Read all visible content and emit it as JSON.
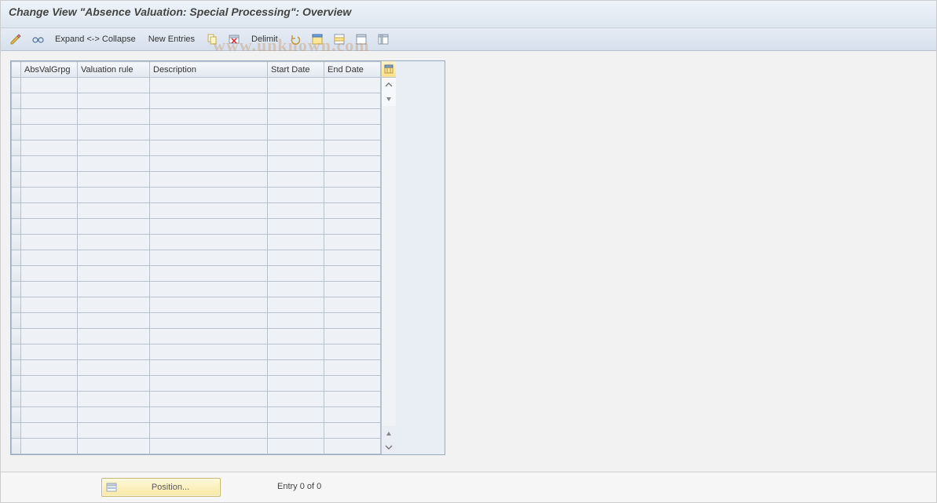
{
  "title": "Change View \"Absence Valuation: Special Processing\": Overview",
  "watermark": "www.unknown.com",
  "toolbar": {
    "expand_collapse": "Expand <-> Collapse",
    "new_entries": "New Entries",
    "delimit": "Delimit"
  },
  "columns": {
    "grpg": "AbsValGrpg",
    "rule": "Valuation rule",
    "desc": "Description",
    "start": "Start Date",
    "end": "End Date"
  },
  "num_rows": 24,
  "footer": {
    "position_label": "Position...",
    "entry_text": "Entry 0 of 0"
  }
}
